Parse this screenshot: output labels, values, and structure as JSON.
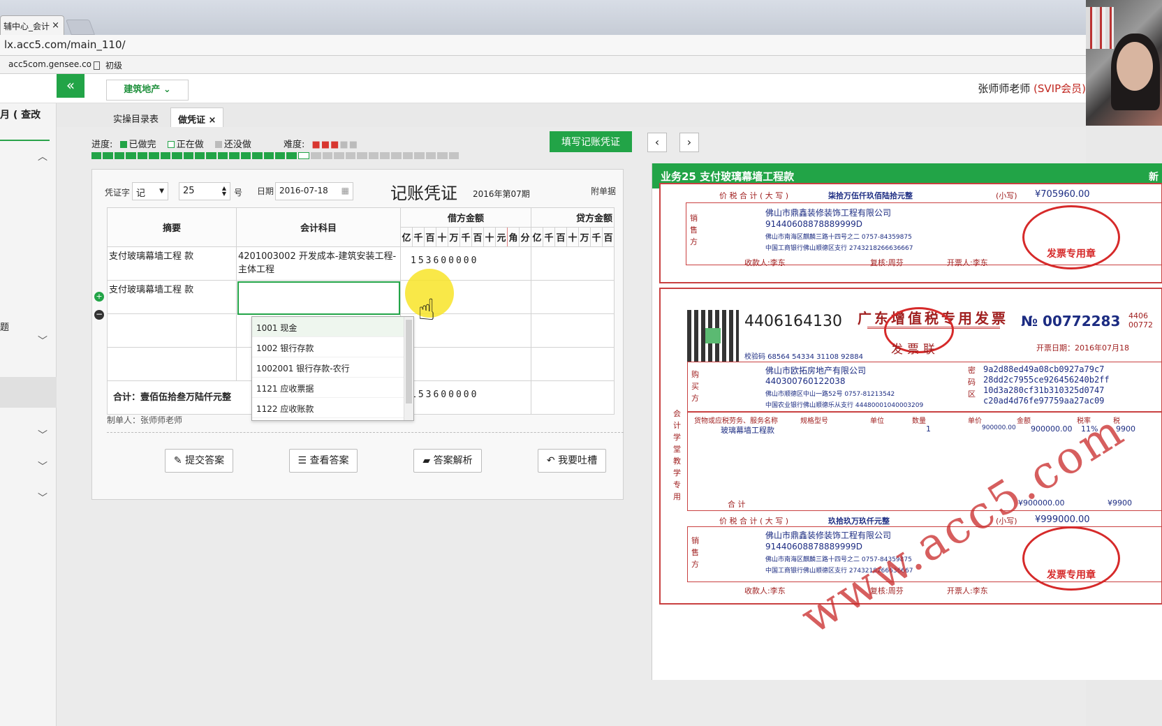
{
  "browser": {
    "tab_title": "辅中心_会计",
    "url": "lx.acc5.com/main_110/",
    "bookmarks": [
      "acc5com.gensee.co",
      "初级"
    ]
  },
  "header": {
    "collapse_glyph": "«",
    "industry": "建筑地产",
    "user_name": "张师师老师",
    "user_level": "(SVIP会员)"
  },
  "sidebar": {
    "title": "月 ( 查改",
    "fragment": "题"
  },
  "tabs": [
    "实操目录表",
    "做凭证"
  ],
  "progress": {
    "label": "进度:",
    "done_label": "已做完",
    "doing_label": "正在做",
    "todo_label": "还没做",
    "difficulty_label": "难度:",
    "done_count": 18,
    "current_index": 18,
    "total": 32,
    "difficulty": 3
  },
  "toolbar": {
    "fill_voucher": "填写记账凭证",
    "prev": "‹",
    "next": "›"
  },
  "voucher": {
    "type_label": "凭证字",
    "type_value": "记",
    "number_value": "25",
    "number_suffix": "号",
    "date_label": "日期",
    "date_value": "2016-07-18",
    "title": "记账凭证",
    "period": "2016年第07期",
    "attachments_label": "附单据",
    "col_summary": "摘要",
    "col_account": "会计科目",
    "col_debit": "借方金额",
    "col_credit": "贷方金额",
    "digit_headers_debit": [
      "亿",
      "千",
      "百",
      "十",
      "万",
      "千",
      "百",
      "十",
      "元",
      "角",
      "分"
    ],
    "digit_headers_credit": [
      "亿",
      "千",
      "百",
      "十",
      "万",
      "千",
      "百"
    ],
    "rows": [
      {
        "summary": "支付玻璃幕墙工程 款",
        "account": "4201003002 开发成本-建筑安装工程-主体工程",
        "debit": "153600000"
      },
      {
        "summary": "支付玻璃幕墙工程 款",
        "account": "",
        "debit": ""
      },
      {
        "summary": "",
        "account": "",
        "debit": ""
      },
      {
        "summary": "",
        "account": "",
        "debit": ""
      }
    ],
    "total_label": "合计：壹佰伍拾叁万陆仟元整",
    "total_debit": "153600000",
    "preparer": "制单人：张师师老师",
    "dropdown_items": [
      "1001 现金",
      "1002 银行存款",
      "1002001 银行存款-农行",
      "1121 应收票据",
      "1122 应收账款"
    ],
    "buttons": [
      "提交答案",
      "查看答案",
      "答案解析",
      "我要吐槽"
    ]
  },
  "invoice_panel": {
    "title": "业务25 支付玻璃幕墙工程款",
    "new_tag": "新",
    "top": {
      "total_upper_label": "价 税 合 计 ( 大 写 )",
      "total_upper": "柒拾万伍仟玖佰陆拾元整",
      "total_small_label": "(小写)",
      "total_small": "¥705960.00",
      "seller_name": "佛山市鼎鑫装修装饰工程有限公司",
      "seller_tax_id": "91440608878889999D",
      "seller_address": "佛山市南海区麒麟三路十四号之二 0757-84359875",
      "seller_bank": "中国工商银行佛山顺德区支行 2743218266636667",
      "payee": "收款人:李东",
      "reviewer": "复核:周芬",
      "issuer": "开票人:李东",
      "seal_text": "发票专用章",
      "seller_label": "销售方"
    },
    "main": {
      "code": "4406164130",
      "title": "广东增值税专用发票",
      "no_prefix": "№",
      "no": "00772283",
      "no_side": "4406 00772",
      "copy_label": "发票联",
      "issue_date": "开票日期：2016年07月18",
      "check_code": "校验码 68564 54334 31108 92884",
      "buyer_name": "佛山市欧拓房地产有限公司",
      "buyer_tax_id": "440300760122038",
      "buyer_address": "佛山市顺德区中山一路52号 0757-81213542",
      "buyer_bank": "中国农业银行佛山顺德乐从支行 44480001040003209",
      "cipher": [
        "9a2d88ed49a08cb0927a79c7",
        "28dd2c7955ce926456240b2ff",
        "10d3a280cf31b310325d0747",
        "c20ad4d76fe97759aa27ac09"
      ],
      "col_headers": [
        "货物或应税劳务、服务名称",
        "规格型号",
        "单位",
        "数量",
        "单价",
        "金额",
        "税率",
        "税"
      ],
      "item_name": "玻璃幕墙工程款",
      "item_qty": "1",
      "item_price": "900000.00",
      "item_amount": "900000.00",
      "item_rate": "11%",
      "item_tax": "9900",
      "sum_label": "合 计",
      "sum_amount": "¥900000.00",
      "sum_tax": "¥9900",
      "total_upper_label": "价 税 合 计 ( 大 写 )",
      "total_upper": "玖拾玖万玖仟元整",
      "total_small_label": "(小写)",
      "total_small": "¥999000.00",
      "seller_name": "佛山市鼎鑫装修装饰工程有限公司",
      "seller_tax_id": "91440608878889999D",
      "seller_address": "佛山市南海区麒麟三路十四号之二 0757-84359875",
      "seller_bank": "中国工商银行佛山顺德区支行 2743218266636667",
      "payee": "收款人:李东",
      "reviewer": "复核:周芬",
      "issuer": "开票人:李东",
      "seal_text": "发票专用章",
      "side_text": "会计学堂教学专用",
      "watermark": "www.acc5.com",
      "buyer_label": "购买方",
      "seller_label": "销售方",
      "cipher_label": "密码区"
    }
  }
}
